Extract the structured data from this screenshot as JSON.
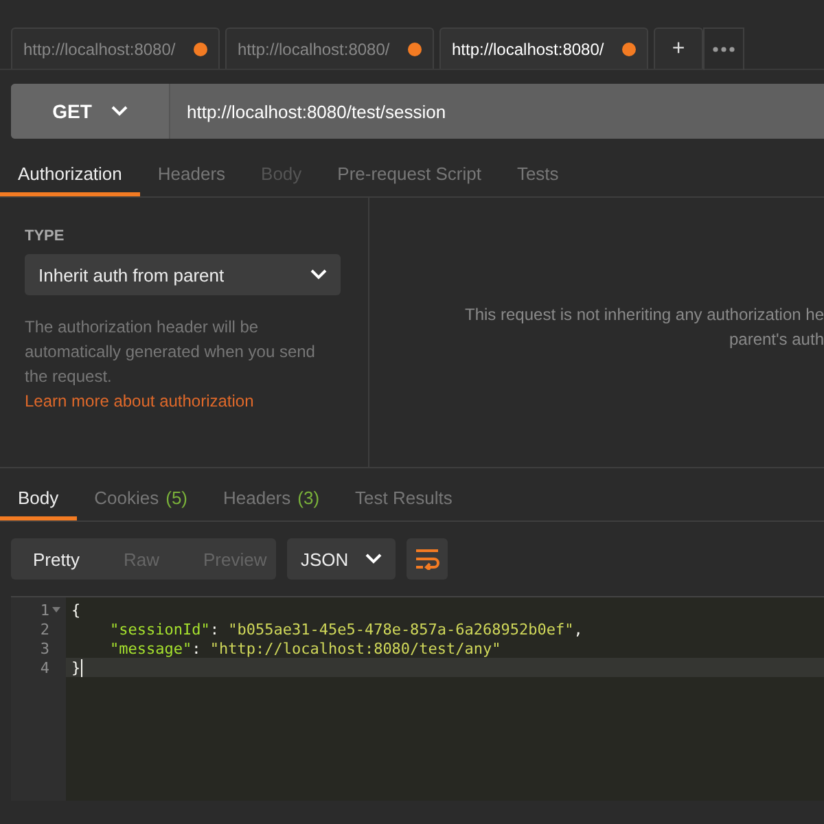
{
  "tabs": [
    {
      "label": "http://localhost:8080/",
      "selected": false,
      "unsaved": true
    },
    {
      "label": "http://localhost:8080/",
      "selected": false,
      "unsaved": true
    },
    {
      "label": "http://localhost:8080/",
      "selected": true,
      "unsaved": true
    }
  ],
  "tab_actions": {
    "add": "+"
  },
  "request": {
    "method": "GET",
    "url": "http://localhost:8080/test/session"
  },
  "request_tabs": [
    {
      "label": "Authorization",
      "selected": true,
      "disabled": false
    },
    {
      "label": "Headers",
      "selected": false,
      "disabled": false
    },
    {
      "label": "Body",
      "selected": false,
      "disabled": true
    },
    {
      "label": "Pre-request Script",
      "selected": false,
      "disabled": false
    },
    {
      "label": "Tests",
      "selected": false,
      "disabled": false
    }
  ],
  "auth": {
    "type_label": "TYPE",
    "type_value": "Inherit auth from parent",
    "description": "The authorization header will be automatically generated when you send the request.",
    "link": "Learn more about authorization",
    "message_lines": [
      "This request is not inheriting any authorization he",
      "parent's auth"
    ]
  },
  "response_tabs": [
    {
      "label": "Body",
      "selected": true
    },
    {
      "label": "Cookies",
      "count": "(5)",
      "selected": false
    },
    {
      "label": "Headers",
      "count": "(3)",
      "selected": false
    },
    {
      "label": "Test Results",
      "selected": false
    }
  ],
  "view_modes": [
    {
      "label": "Pretty",
      "selected": true
    },
    {
      "label": "Raw",
      "selected": false
    },
    {
      "label": "Preview",
      "selected": false
    }
  ],
  "format": "JSON",
  "code_lines": [
    {
      "number": "1",
      "foldable": true,
      "current": false,
      "tokens": [
        {
          "kind": "punct",
          "text": "{"
        }
      ]
    },
    {
      "number": "2",
      "foldable": false,
      "current": false,
      "tokens": [
        {
          "kind": "key",
          "text": "\"sessionId\""
        },
        {
          "kind": "punct",
          "text": ": "
        },
        {
          "kind": "string",
          "text": "\"b055ae31-45e5-478e-857a-6a268952b0ef\""
        },
        {
          "kind": "punct",
          "text": ","
        }
      ]
    },
    {
      "number": "3",
      "foldable": false,
      "current": false,
      "tokens": [
        {
          "kind": "key",
          "text": "\"message\""
        },
        {
          "kind": "punct",
          "text": ": "
        },
        {
          "kind": "string",
          "text": "\"http://localhost:8080/test/any\""
        }
      ]
    },
    {
      "number": "4",
      "foldable": false,
      "current": true,
      "tokens": [
        {
          "kind": "punct",
          "text": "}"
        }
      ]
    }
  ]
}
